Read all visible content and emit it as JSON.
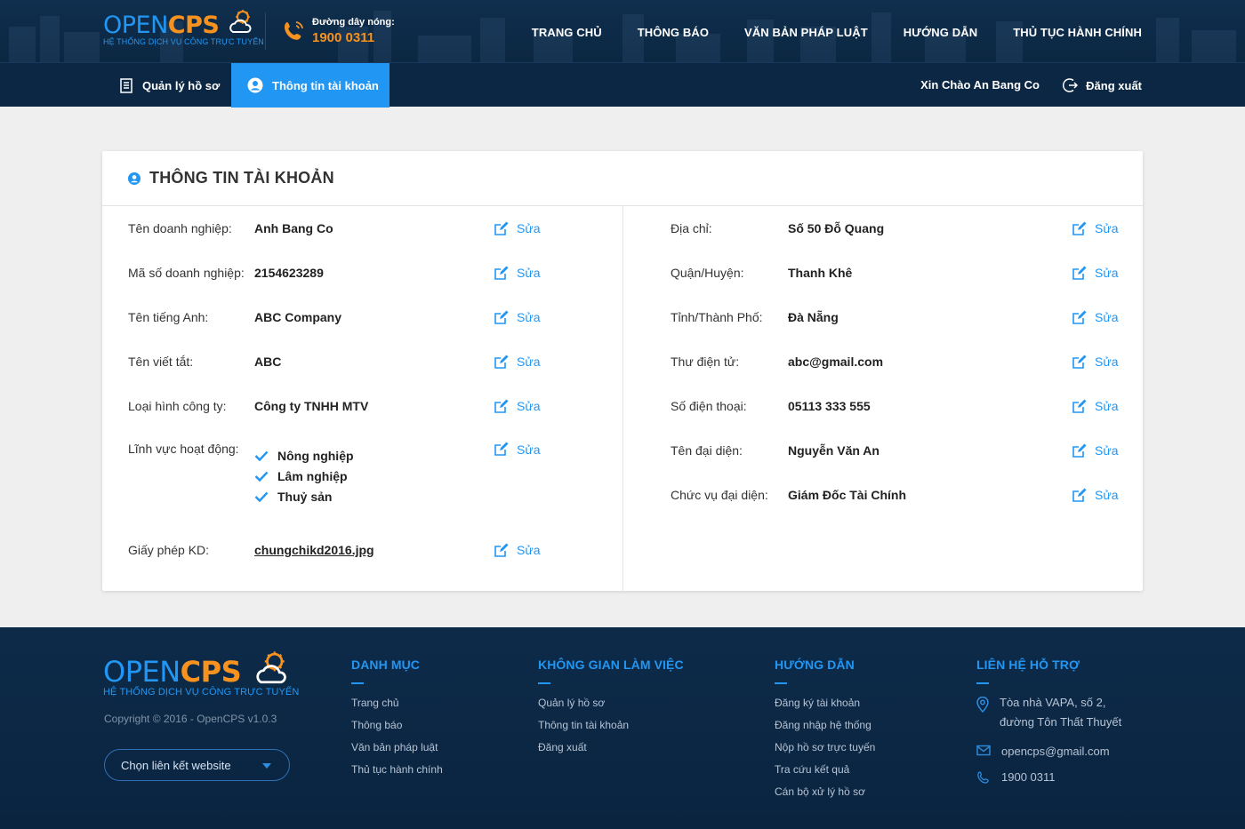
{
  "brand": {
    "logo_open": "OPEN",
    "logo_cps": "CPS",
    "tagline": "HỆ THỐNG DỊCH VỤ CÔNG TRỰC TUYẾN",
    "colors": {
      "blue": "#2196f3",
      "orange": "#f7921e",
      "navy": "#0c2743"
    }
  },
  "hotline": {
    "label": "Đường dây nóng:",
    "number": "1900 0311",
    "icon": "phone-icon"
  },
  "nav": {
    "items": [
      "TRANG CHỦ",
      "THÔNG BÁO",
      "VĂN BẢN PHÁP LUẬT",
      "HƯỚNG DẪN",
      "THỦ TỤC HÀNH CHÍNH"
    ]
  },
  "subnav": {
    "tab_records": "Quản lý hồ sơ",
    "tab_account": "Thông tin tài khoản",
    "active_tab": "Thông tin tài khoản",
    "greeting": "Xin Chào An Bang Co",
    "logout": "Đăng xuất"
  },
  "card": {
    "title": "THÔNG TIN TÀI KHOẢN",
    "edit_label": "Sửa",
    "left": {
      "company_name": {
        "label": "Tên doanh nghiệp:",
        "value": "Anh Bang Co"
      },
      "tax_code": {
        "label": "Mã số doanh nghiệp:",
        "value": "2154623289"
      },
      "english_name": {
        "label": "Tên tiếng Anh:",
        "value": "ABC Company"
      },
      "short_name": {
        "label": "Tên viết tắt:",
        "value": "ABC"
      },
      "company_type": {
        "label": "Loại hình công ty:",
        "value": "Công ty TNHH MTV"
      },
      "fields": {
        "label": "Lĩnh vực hoạt động:",
        "values": [
          "Nông nghiệp",
          "Lâm nghiệp",
          "Thuỷ sản"
        ]
      },
      "license": {
        "label": "Giấy phép KD:",
        "value": "chungchikd2016.jpg"
      }
    },
    "right": {
      "address": {
        "label": "Địa chỉ:",
        "value": "Số 50 Đỗ Quang"
      },
      "district": {
        "label": "Quận/Huyện:",
        "value": "Thanh Khê"
      },
      "province": {
        "label": "Tỉnh/Thành Phố:",
        "value": "Đà Nẵng"
      },
      "email": {
        "label": "Thư điện tử:",
        "value": "abc@gmail.com"
      },
      "phone": {
        "label": "Số điện thoại:",
        "value": "05113 333 555"
      },
      "representative": {
        "label": "Tên đại diện:",
        "value": "Nguyễn Văn An"
      },
      "rep_position": {
        "label": "Chức vụ đại diện:",
        "value": "Giám Đốc Tài Chính"
      }
    }
  },
  "footer": {
    "copyright": "Copyright © 2016 - OpenCPS v1.0.3",
    "select_placeholder": "Chọn liên kết website",
    "danh_muc": {
      "title": "DANH MỤC",
      "links": [
        "Trang chủ",
        "Thông báo",
        "Văn bản pháp luật",
        "Thủ tục hành chính"
      ]
    },
    "workspace": {
      "title": "KHÔNG GIAN LÀM VIỆC",
      "links": [
        "Quản lý hồ sơ",
        "Thông tin tài khoản",
        "Đăng xuất"
      ]
    },
    "guide": {
      "title": "HƯỚNG DẪN",
      "links": [
        "Đăng ký tài khoản",
        "Đăng nhập hệ thống",
        "Nộp hồ sơ trực tuyến",
        "Tra cứu kết quả",
        "Cán bộ xử lý hồ sơ"
      ]
    },
    "support": {
      "title": "LIÊN HỆ HỖ TRỢ",
      "address_line1": "Tòa nhà VAPA, số 2,",
      "address_line2": "đường Tôn Thất Thuyết",
      "email": "opencps@gmail.com",
      "phone": "1900 0311"
    }
  }
}
